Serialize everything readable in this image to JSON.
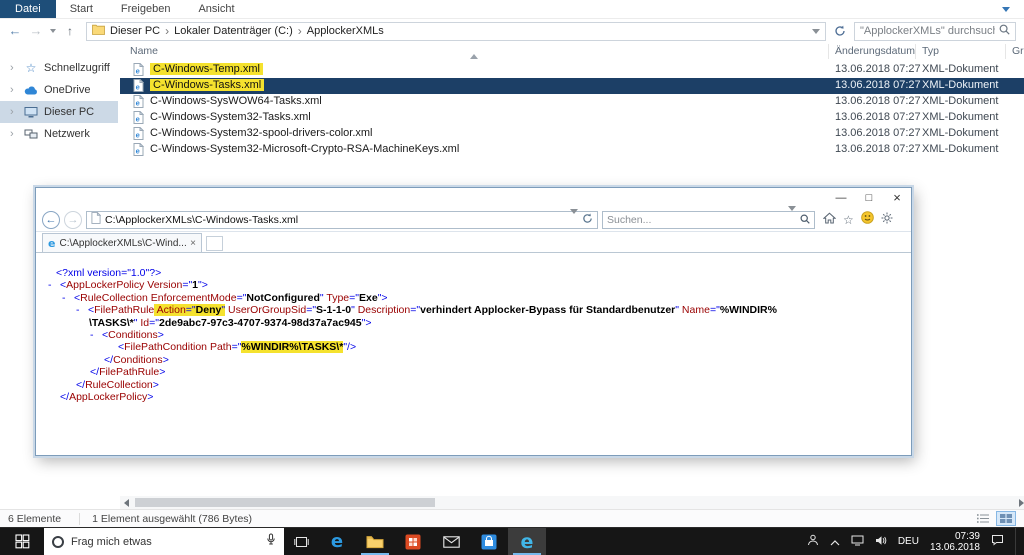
{
  "colors": {
    "accent": "#1e4e79",
    "highlight": "#f5e22e",
    "selection": "#1c3f66",
    "xml-markup": "#0000e8",
    "xml-tag": "#990000"
  },
  "explorer": {
    "ribbon": {
      "file_tab": "Datei",
      "tabs": [
        "Start",
        "Freigeben",
        "Ansicht"
      ]
    },
    "address": {
      "breadcrumb": [
        "Dieser PC",
        "Lokaler Datenträger (C:)",
        "ApplockerXMLs"
      ],
      "search_placeholder": "\"ApplockerXMLs\" durchsuchen"
    },
    "columns": {
      "name": "Name",
      "modified": "Änderungsdatum",
      "type": "Typ",
      "size": "Gr"
    },
    "sidebar": [
      {
        "label": "Schnellzugriff"
      },
      {
        "label": "OneDrive"
      },
      {
        "label": "Dieser PC"
      },
      {
        "label": "Netzwerk"
      }
    ],
    "files": [
      {
        "name": "C-Windows-Temp.xml",
        "modified": "13.06.2018 07:27",
        "type": "XML-Dokument",
        "highlight": true
      },
      {
        "name": "C-Windows-Tasks.xml",
        "modified": "13.06.2018 07:27",
        "type": "XML-Dokument",
        "highlight": true,
        "selected": true
      },
      {
        "name": "C-Windows-SysWOW64-Tasks.xml",
        "modified": "13.06.2018 07:27",
        "type": "XML-Dokument"
      },
      {
        "name": "C-Windows-System32-Tasks.xml",
        "modified": "13.06.2018 07:27",
        "type": "XML-Dokument"
      },
      {
        "name": "C-Windows-System32-spool-drivers-color.xml",
        "modified": "13.06.2018 07:27",
        "type": "XML-Dokument"
      },
      {
        "name": "C-Windows-System32-Microsoft-Crypto-RSA-MachineKeys.xml",
        "modified": "13.06.2018 07:27",
        "type": "XML-Dokument"
      }
    ],
    "status": {
      "count": "6 Elemente",
      "selection": "1 Element ausgewählt (786 Bytes)"
    }
  },
  "ie": {
    "address": "C:\\ApplockerXMLs\\C-Windows-Tasks.xml",
    "search_placeholder": "Suchen...",
    "tab_title": "C:\\ApplockerXMLs\\C-Wind...",
    "xml": {
      "lines": [
        {
          "pad": 8,
          "tokens": [
            [
              "m",
              "<?xml version=\"1.0\"?>"
            ]
          ]
        },
        {
          "pad": 0,
          "dash": true,
          "tokens": [
            [
              "m",
              "<"
            ],
            [
              "t",
              "AppLockerPolicy"
            ],
            [
              "t",
              " Version"
            ],
            [
              "m",
              "=\""
            ],
            [
              "b",
              "1"
            ],
            [
              "m",
              "\">"
            ]
          ]
        },
        {
          "pad": 14,
          "dash": true,
          "tokens": [
            [
              "m",
              "<"
            ],
            [
              "t",
              "RuleCollection"
            ],
            [
              "t",
              " EnforcementMode"
            ],
            [
              "m",
              "=\""
            ],
            [
              "b",
              "NotConfigured"
            ],
            [
              "m",
              "\""
            ],
            [
              "t",
              " Type"
            ],
            [
              "m",
              "=\""
            ],
            [
              "b",
              "Exe"
            ],
            [
              "m",
              "\">"
            ]
          ]
        },
        {
          "pad": 28,
          "dash": true,
          "tokens": [
            [
              "m",
              "<"
            ],
            [
              "t",
              "FilePathRule"
            ],
            [
              "t",
              " Action",
              "h"
            ],
            [
              "m",
              "=\"",
              "h"
            ],
            [
              "b",
              "Deny",
              "h"
            ],
            [
              "m",
              "\"",
              "h"
            ],
            [
              "t",
              " UserOrGroupSid"
            ],
            [
              "m",
              "=\""
            ],
            [
              "b",
              "S-1-1-0"
            ],
            [
              "m",
              "\""
            ],
            [
              "t",
              " Description"
            ],
            [
              "m",
              "=\""
            ],
            [
              "b",
              "verhindert Applocker-Bypass für Standardbenutzer"
            ],
            [
              "m",
              "\""
            ],
            [
              "t",
              " Name"
            ],
            [
              "m",
              "=\""
            ],
            [
              "b",
              "%WINDIR%"
            ]
          ]
        },
        {
          "pad": 41,
          "tokens": [
            [
              "b",
              "\\TASKS\\*"
            ],
            [
              "m",
              "\""
            ],
            [
              "t",
              " Id"
            ],
            [
              "m",
              "=\""
            ],
            [
              "b",
              "2de9abc7-97c3-4707-9374-98d37a7ac945"
            ],
            [
              "m",
              "\">"
            ]
          ]
        },
        {
          "pad": 42,
          "dash": true,
          "tokens": [
            [
              "m",
              "<"
            ],
            [
              "t",
              "Conditions"
            ],
            [
              "m",
              ">"
            ]
          ]
        },
        {
          "pad": 70,
          "tokens": [
            [
              "m",
              "<"
            ],
            [
              "t",
              "FilePathCondition"
            ],
            [
              "t",
              " Path"
            ],
            [
              "m",
              "=\""
            ],
            [
              "b",
              "%WINDIR%\\TASKS\\*",
              "h"
            ],
            [
              "m",
              "\"/>"
            ]
          ]
        },
        {
          "pad": 56,
          "tokens": [
            [
              "m",
              "</"
            ],
            [
              "t",
              "Conditions"
            ],
            [
              "m",
              ">"
            ]
          ]
        },
        {
          "pad": 42,
          "tokens": [
            [
              "m",
              "</"
            ],
            [
              "t",
              "FilePathRule"
            ],
            [
              "m",
              ">"
            ]
          ]
        },
        {
          "pad": 28,
          "tokens": [
            [
              "m",
              "</"
            ],
            [
              "t",
              "RuleCollection"
            ],
            [
              "m",
              ">"
            ]
          ]
        },
        {
          "pad": 12,
          "tokens": [
            [
              "m",
              "</"
            ],
            [
              "t",
              "AppLockerPolicy"
            ],
            [
              "m",
              ">"
            ]
          ]
        }
      ]
    }
  },
  "taskbar": {
    "search_placeholder": "Frag mich etwas",
    "tray": {
      "language": "DEU",
      "time": "07:39",
      "date": "13.06.2018"
    }
  }
}
